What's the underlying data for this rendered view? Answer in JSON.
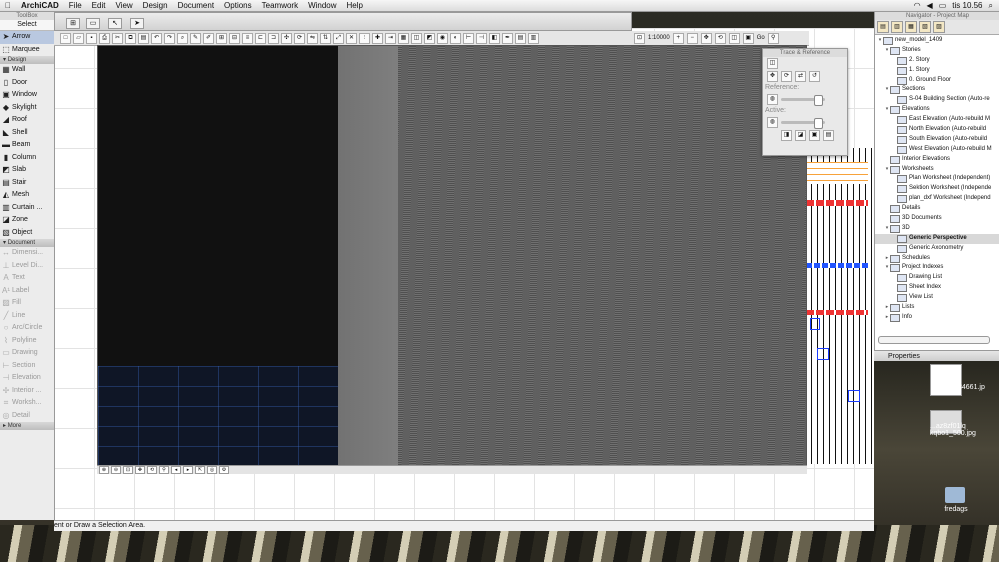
{
  "menubar": {
    "app": "ArchiCAD",
    "items": [
      "File",
      "Edit",
      "View",
      "Design",
      "Document",
      "Options",
      "Teamwork",
      "Window",
      "Help"
    ],
    "clock": "tis 10.56"
  },
  "toolbox": {
    "title": "ToolBox",
    "select_label": "Select",
    "arrow_label": "Arrow",
    "marquee_label": "Marquee",
    "design_header": "Design",
    "design_tools": [
      "Wall",
      "Door",
      "Window",
      "Skylight",
      "Roof",
      "Shell",
      "Beam",
      "Column",
      "Slab",
      "Stair",
      "Mesh",
      "Curtain ...",
      "Zone",
      "Object"
    ],
    "document_header": "Document",
    "document_tools": [
      "Dimensi...",
      "Level Di...",
      "Text",
      "Label",
      "Fill",
      "Line",
      "Arc/Circle",
      "Polyline",
      "Drawing",
      "Section",
      "Elevation",
      "Interior ...",
      "Worksh...",
      "Detail"
    ],
    "more_header": "More"
  },
  "toolbar": {
    "zoom_value": "1:10000",
    "go_label": "Go"
  },
  "trace_palette": {
    "title": "Trace & Reference",
    "reference_label": "Reference:",
    "active_label": "Active:"
  },
  "navigator": {
    "title": "Navigator - Project Map",
    "tree": [
      {
        "label": "new_model_1409",
        "indent": 0,
        "twisty": "▾"
      },
      {
        "label": "Stories",
        "indent": 1,
        "twisty": "▾"
      },
      {
        "label": "2. Story",
        "indent": 2,
        "twisty": ""
      },
      {
        "label": "1. Story",
        "indent": 2,
        "twisty": ""
      },
      {
        "label": "0. Ground Floor",
        "indent": 2,
        "twisty": ""
      },
      {
        "label": "Sections",
        "indent": 1,
        "twisty": "▾"
      },
      {
        "label": "S-04 Building Section (Auto-re",
        "indent": 2,
        "twisty": ""
      },
      {
        "label": "Elevations",
        "indent": 1,
        "twisty": "▾"
      },
      {
        "label": "East Elevation (Auto-rebuild M",
        "indent": 2,
        "twisty": ""
      },
      {
        "label": "North Elevation (Auto-rebuild",
        "indent": 2,
        "twisty": ""
      },
      {
        "label": "South Elevation (Auto-rebuild",
        "indent": 2,
        "twisty": ""
      },
      {
        "label": "West Elevation (Auto-rebuild M",
        "indent": 2,
        "twisty": ""
      },
      {
        "label": "Interior Elevations",
        "indent": 1,
        "twisty": ""
      },
      {
        "label": "Worksheets",
        "indent": 1,
        "twisty": "▾"
      },
      {
        "label": "Plan Worksheet (Independent)",
        "indent": 2,
        "twisty": ""
      },
      {
        "label": "Sektion Worksheet (Independe",
        "indent": 2,
        "twisty": ""
      },
      {
        "label": "plan_dxf Worksheet (Independ",
        "indent": 2,
        "twisty": ""
      },
      {
        "label": "Details",
        "indent": 1,
        "twisty": ""
      },
      {
        "label": "3D Documents",
        "indent": 1,
        "twisty": ""
      },
      {
        "label": "3D",
        "indent": 1,
        "twisty": "▾"
      },
      {
        "label": "Generic Perspective",
        "indent": 2,
        "twisty": "",
        "selected": true
      },
      {
        "label": "Generic Axonometry",
        "indent": 2,
        "twisty": ""
      },
      {
        "label": "Schedules",
        "indent": 1,
        "twisty": "▸"
      },
      {
        "label": "Project Indexes",
        "indent": 1,
        "twisty": "▾"
      },
      {
        "label": "Drawing List",
        "indent": 2,
        "twisty": ""
      },
      {
        "label": "Sheet Index",
        "indent": 2,
        "twisty": ""
      },
      {
        "label": "View List",
        "indent": 2,
        "twisty": ""
      },
      {
        "label": "Lists",
        "indent": 1,
        "twisty": "▸"
      },
      {
        "label": "Info",
        "indent": 1,
        "twisty": "▸"
      }
    ],
    "properties_label": "Properties"
  },
  "statusbar": {
    "text": "ent or Draw a Selection Area."
  },
  "desktop": {
    "file1_label": "34661.jp",
    "file2_label": "...az8zf01lq\nkqbo1_500.jpg",
    "folder_label": "fredags"
  }
}
